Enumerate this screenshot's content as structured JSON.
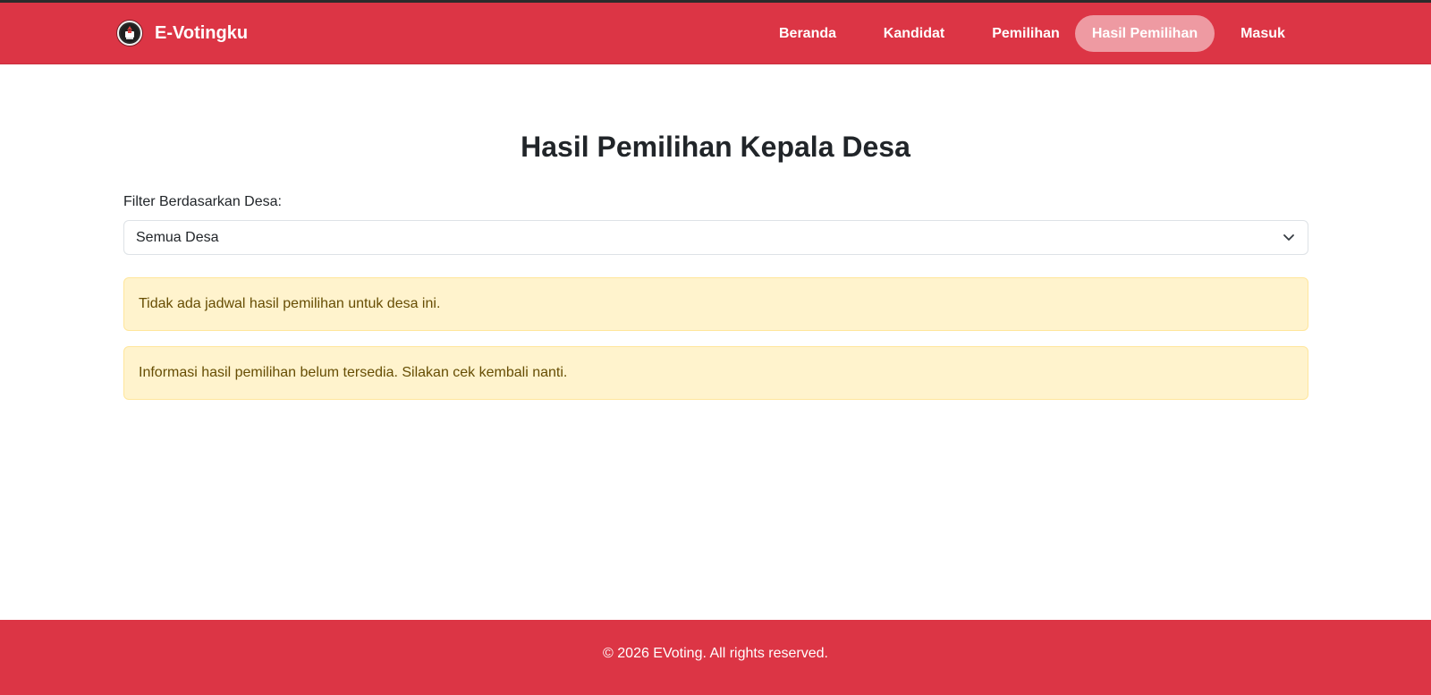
{
  "navbar": {
    "brand": "E-Votingku",
    "logo_icon": "party-emblem-icon",
    "items": [
      {
        "label": "Beranda",
        "active": false
      },
      {
        "label": "Kandidat",
        "active": false
      },
      {
        "label": "Pemilihan",
        "active": false
      },
      {
        "label": "Hasil Pemilihan",
        "active": true
      },
      {
        "label": "Masuk",
        "active": false
      }
    ]
  },
  "main": {
    "title": "Hasil Pemilihan Kepala Desa",
    "filter": {
      "label": "Filter Berdasarkan Desa:",
      "selected": "Semua Desa",
      "icon": "chevron-down-icon"
    },
    "alerts": [
      {
        "text": "Tidak ada jadwal hasil pemilihan untuk desa ini."
      },
      {
        "text": "Informasi hasil pemilihan belum tersedia. Silakan cek kembali nanti."
      }
    ]
  },
  "footer": {
    "text": "© 2026 EVoting. All rights reserved."
  },
  "colors": {
    "primary": "#dc3545",
    "active_nav": "#ee9aa2",
    "alert_bg": "#fff3cd",
    "alert_border": "#ffe69c",
    "alert_text": "#664d03"
  }
}
